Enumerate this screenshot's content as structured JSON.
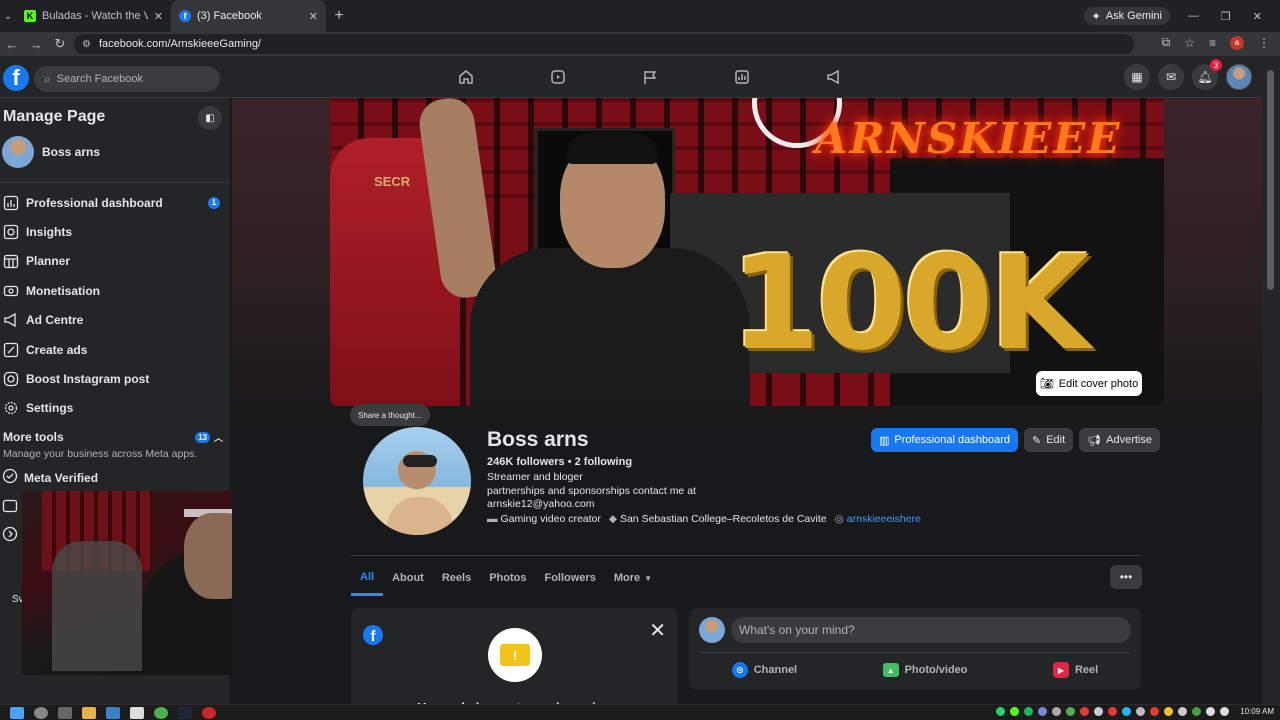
{
  "browser": {
    "tabs": [
      {
        "label": "Buladas - Watch the VOD on K",
        "favicon": "K",
        "active": false
      },
      {
        "label": "(3) Facebook",
        "favicon": "f",
        "active": true
      }
    ],
    "ask_gemini": "Ask Gemini",
    "url": "facebook.com/ArnskieeeGaming/",
    "profile_initial": "a"
  },
  "fb": {
    "search_placeholder": "Search Facebook",
    "notifications_count": "3"
  },
  "sidebar": {
    "title": "Manage Page",
    "profile_name": "Boss arns",
    "items": [
      {
        "label": "Professional dashboard",
        "icon": "dashboard-icon",
        "badge": "1"
      },
      {
        "label": "Insights",
        "icon": "insights-icon",
        "badge": ""
      },
      {
        "label": "Planner",
        "icon": "planner-icon",
        "badge": ""
      },
      {
        "label": "Monetisation",
        "icon": "monetisation-icon",
        "badge": ""
      },
      {
        "label": "Ad Centre",
        "icon": "megaphone-icon",
        "badge": ""
      },
      {
        "label": "Create ads",
        "icon": "pencil-icon",
        "badge": ""
      },
      {
        "label": "Boost Instagram post",
        "icon": "instagram-icon",
        "badge": ""
      },
      {
        "label": "Settings",
        "icon": "gear-icon",
        "badge": ""
      }
    ],
    "more_tools": {
      "label": "More tools",
      "badge": "13",
      "sub": "Manage your business across Meta apps."
    },
    "meta_verified": "Meta Verified",
    "tail_text": "Sv"
  },
  "profile": {
    "cover_edit_label": "Edit cover photo",
    "neon_sign": "ARNSKIEEE",
    "balloons": "100K",
    "chair_logo": "SECR",
    "thought_label": "Share a thought...",
    "name": "Boss arns",
    "stats": "246K followers • 2 following",
    "bio_lines": [
      "Streamer and bloger",
      "partnerships and sponsorships contact me at",
      "arnskie12@yahoo.com"
    ],
    "meta": {
      "category": "Gaming video creator",
      "school": "San Sebastian College–Recoletos de Cavite",
      "instagram": "arnskieeeishere"
    },
    "buttons": {
      "dashboard": "Professional dashboard",
      "edit": "Edit",
      "advertise": "Advertise"
    },
    "tabs": [
      "All",
      "About",
      "Reels",
      "Photos",
      "Followers",
      "More"
    ]
  },
  "ads_card": {
    "title": "Your ads have stopped running"
  },
  "composer": {
    "placeholder": "What's on your mind?",
    "actions": [
      "Channel",
      "Photo/video",
      "Reel"
    ]
  },
  "taskbar": {
    "clock": "10:09 AM"
  }
}
